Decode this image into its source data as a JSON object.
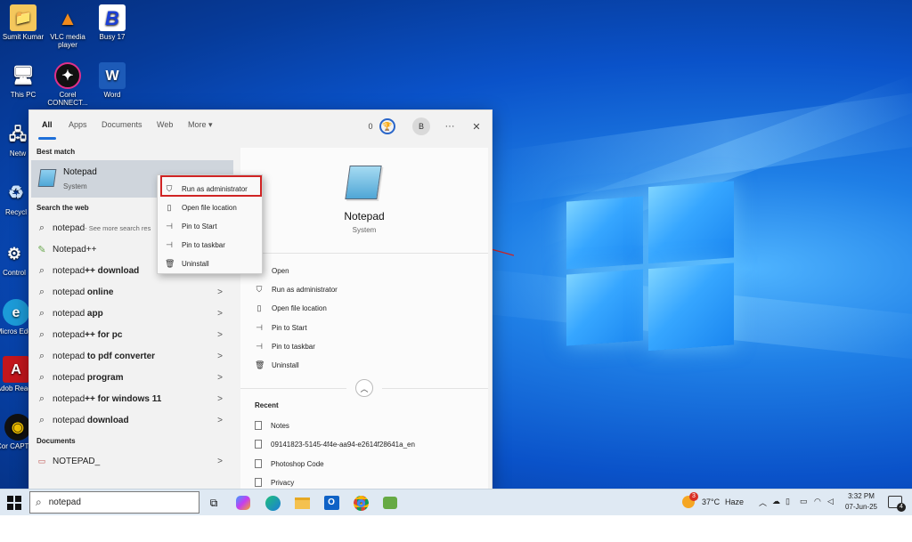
{
  "desktop": {
    "icons": [
      {
        "label": "Sumit Kumar",
        "glyph": "📁",
        "color": "#e8b54a"
      },
      {
        "label": "VLC media player",
        "glyph": "▲",
        "color": "#f08a1c"
      },
      {
        "label": "Busy 17",
        "glyph": "B",
        "color": "#1b3fd6"
      },
      {
        "label": "This PC",
        "glyph": "🖥",
        "color": "#3b8fd9"
      },
      {
        "label": "Corel CONNECT...",
        "glyph": "✦",
        "color": "#111111"
      },
      {
        "label": "Word",
        "glyph": "W",
        "color": "#1d5bb8"
      },
      {
        "label": "Netw",
        "glyph": "🖧",
        "color": "#3b8fd9"
      },
      {
        "label": "Recycl",
        "glyph": "♻",
        "color": "#6fa8dc"
      },
      {
        "label": "Control",
        "glyph": "⚙",
        "color": "#3b8fd9"
      },
      {
        "label": "Micros Edge",
        "glyph": "e",
        "color": "#1c9bd8"
      },
      {
        "label": "Adob Reade",
        "glyph": "A",
        "color": "#c4161c"
      },
      {
        "label": "Cor CAPTUR",
        "glyph": "◉",
        "color": "#f2c100"
      }
    ]
  },
  "search_panel": {
    "tabs": [
      "All",
      "Apps",
      "Documents",
      "Web",
      "More"
    ],
    "more_caret": "▾",
    "points": "0",
    "avatar_letter": "B",
    "ellipsis": "···",
    "close": "✕",
    "best_match_label": "Best match",
    "best_match": {
      "title": "Notepad",
      "subtitle": "System"
    },
    "search_web_label": "Search the web",
    "web_results": [
      {
        "pre": "notepad",
        "bold": "",
        "suffix": " - See more search res"
      },
      {
        "pre": "Notepad++",
        "bold": "",
        "suffix": ""
      },
      {
        "pre": "notepad",
        "bold": "++ download",
        "suffix": ""
      },
      {
        "pre": "notepad",
        "bold": " online",
        "suffix": ""
      },
      {
        "pre": "notepad",
        "bold": " app",
        "suffix": ""
      },
      {
        "pre": "notepad",
        "bold": "++ for pc",
        "suffix": ""
      },
      {
        "pre": "notepad",
        "bold": " to pdf converter",
        "suffix": ""
      },
      {
        "pre": "notepad",
        "bold": " program",
        "suffix": ""
      },
      {
        "pre": "notepad",
        "bold": "++ for windows 11",
        "suffix": ""
      },
      {
        "pre": "notepad",
        "bold": " download",
        "suffix": ""
      }
    ],
    "documents_label": "Documents",
    "document_item": "NOTEPAD_",
    "chevron": ">",
    "details": {
      "title": "Notepad",
      "subtitle": "System",
      "actions": [
        "Open",
        "Run as administrator",
        "Open file location",
        "Pin to Start",
        "Pin to taskbar",
        "Uninstall"
      ],
      "recent_label": "Recent",
      "recent_items": [
        "Notes",
        "09141823-5145-4f4e-aa94-e2614f28641a_en",
        "Photoshop Code",
        "Privacy"
      ]
    }
  },
  "context_menu": {
    "items": [
      "Run as administrator",
      "Open file location",
      "Pin to Start",
      "Pin to taskbar",
      "Uninstall"
    ]
  },
  "taskbar": {
    "search_value": "notepad",
    "weather_temp": "37°C",
    "weather_desc": "Haze",
    "weather_badge": "3",
    "time": "3:32 PM",
    "date": "07-Jun-25",
    "notification_count": "4"
  }
}
